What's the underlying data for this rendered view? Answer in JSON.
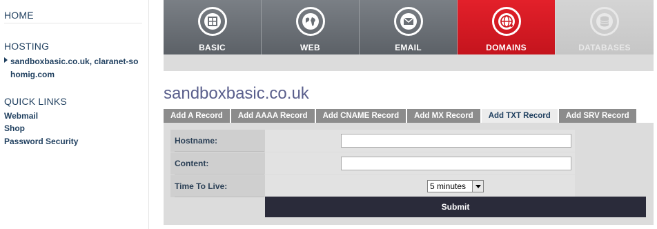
{
  "sidebar": {
    "home": "HOME",
    "hosting": "HOSTING",
    "site": "sandboxbasic.co.uk, claranet-sohomig.com",
    "quick_links_heading": "QUICK LINKS",
    "quick_links": [
      {
        "label": "Webmail"
      },
      {
        "label": "Shop"
      },
      {
        "label": "Password Security"
      }
    ]
  },
  "nav": {
    "tabs": [
      {
        "label": "BASIC",
        "icon": "box-icon"
      },
      {
        "label": "WEB",
        "icon": "globe-icon"
      },
      {
        "label": "EMAIL",
        "icon": "envelope-icon"
      },
      {
        "label": "DOMAINS",
        "icon": "network-globe-icon",
        "active": true
      },
      {
        "label": "DATABASES",
        "icon": "database-icon",
        "disabled": true
      }
    ],
    "active_color": "#d61a23"
  },
  "domain_title": "sandboxbasic.co.uk",
  "record_tabs": [
    {
      "label": "Add A Record"
    },
    {
      "label": "Add AAAA Record"
    },
    {
      "label": "Add CNAME Record"
    },
    {
      "label": "Add MX Record"
    },
    {
      "label": "Add TXT Record",
      "active": true
    },
    {
      "label": "Add SRV Record"
    }
  ],
  "form": {
    "hostname_label": "Hostname:",
    "hostname_value": "",
    "content_label": "Content:",
    "content_value": "",
    "ttl_label": "Time To Live:",
    "ttl_value": "5 minutes",
    "submit_label": "Submit"
  }
}
